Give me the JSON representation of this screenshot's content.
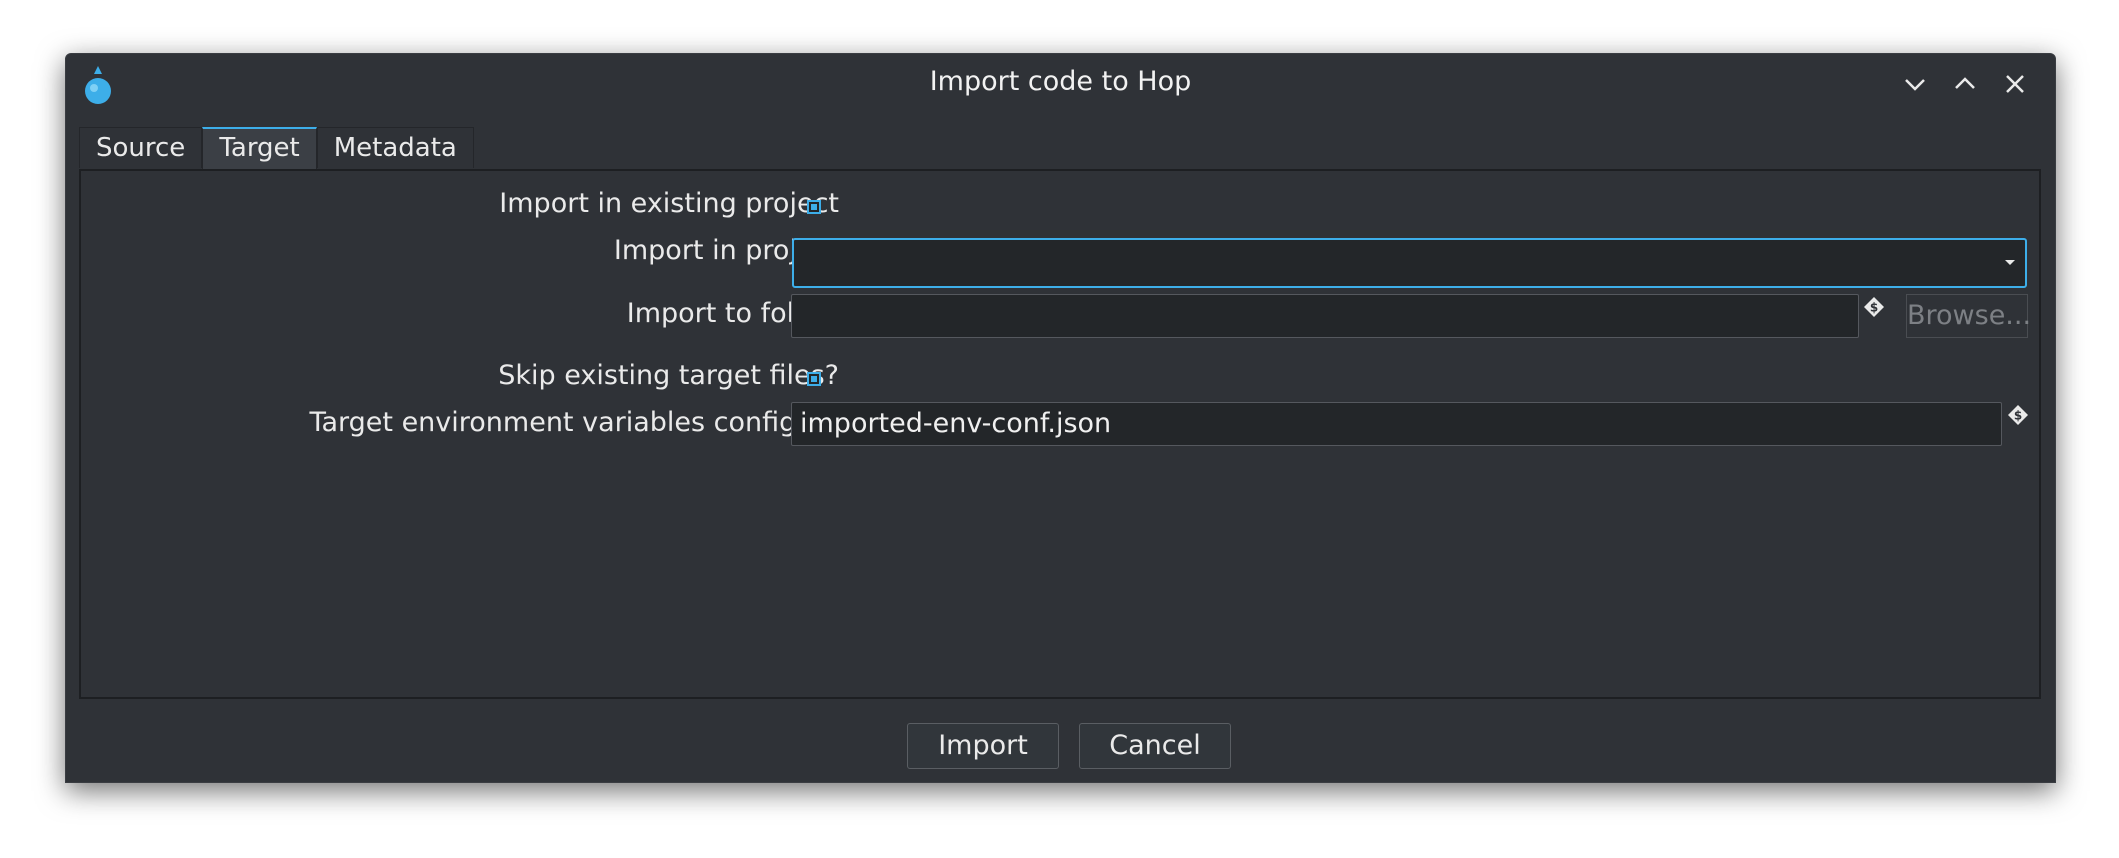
{
  "window": {
    "title": "Import code to Hop"
  },
  "tabs": [
    {
      "label": "Source"
    },
    {
      "label": "Target"
    },
    {
      "label": "Metadata"
    }
  ],
  "form": {
    "import_existing": {
      "label": "Import in existing project",
      "checked": true
    },
    "import_project": {
      "label": "Import in project",
      "value": ""
    },
    "import_folder": {
      "label": "Import to folder",
      "value": "",
      "browse_label": "Browse..."
    },
    "skip_existing": {
      "label": "Skip existing target files?",
      "checked": true
    },
    "env_config": {
      "label": "Target environment variables config file",
      "value": "imported-env-conf.json"
    }
  },
  "footer": {
    "import_label": "Import",
    "cancel_label": "Cancel"
  },
  "icons": {
    "app": "hop-logo-icon",
    "variable": "variable-dollar-icon"
  },
  "colors": {
    "accent": "#3daee9",
    "window_bg": "#2f3237",
    "field_bg": "#232629"
  }
}
